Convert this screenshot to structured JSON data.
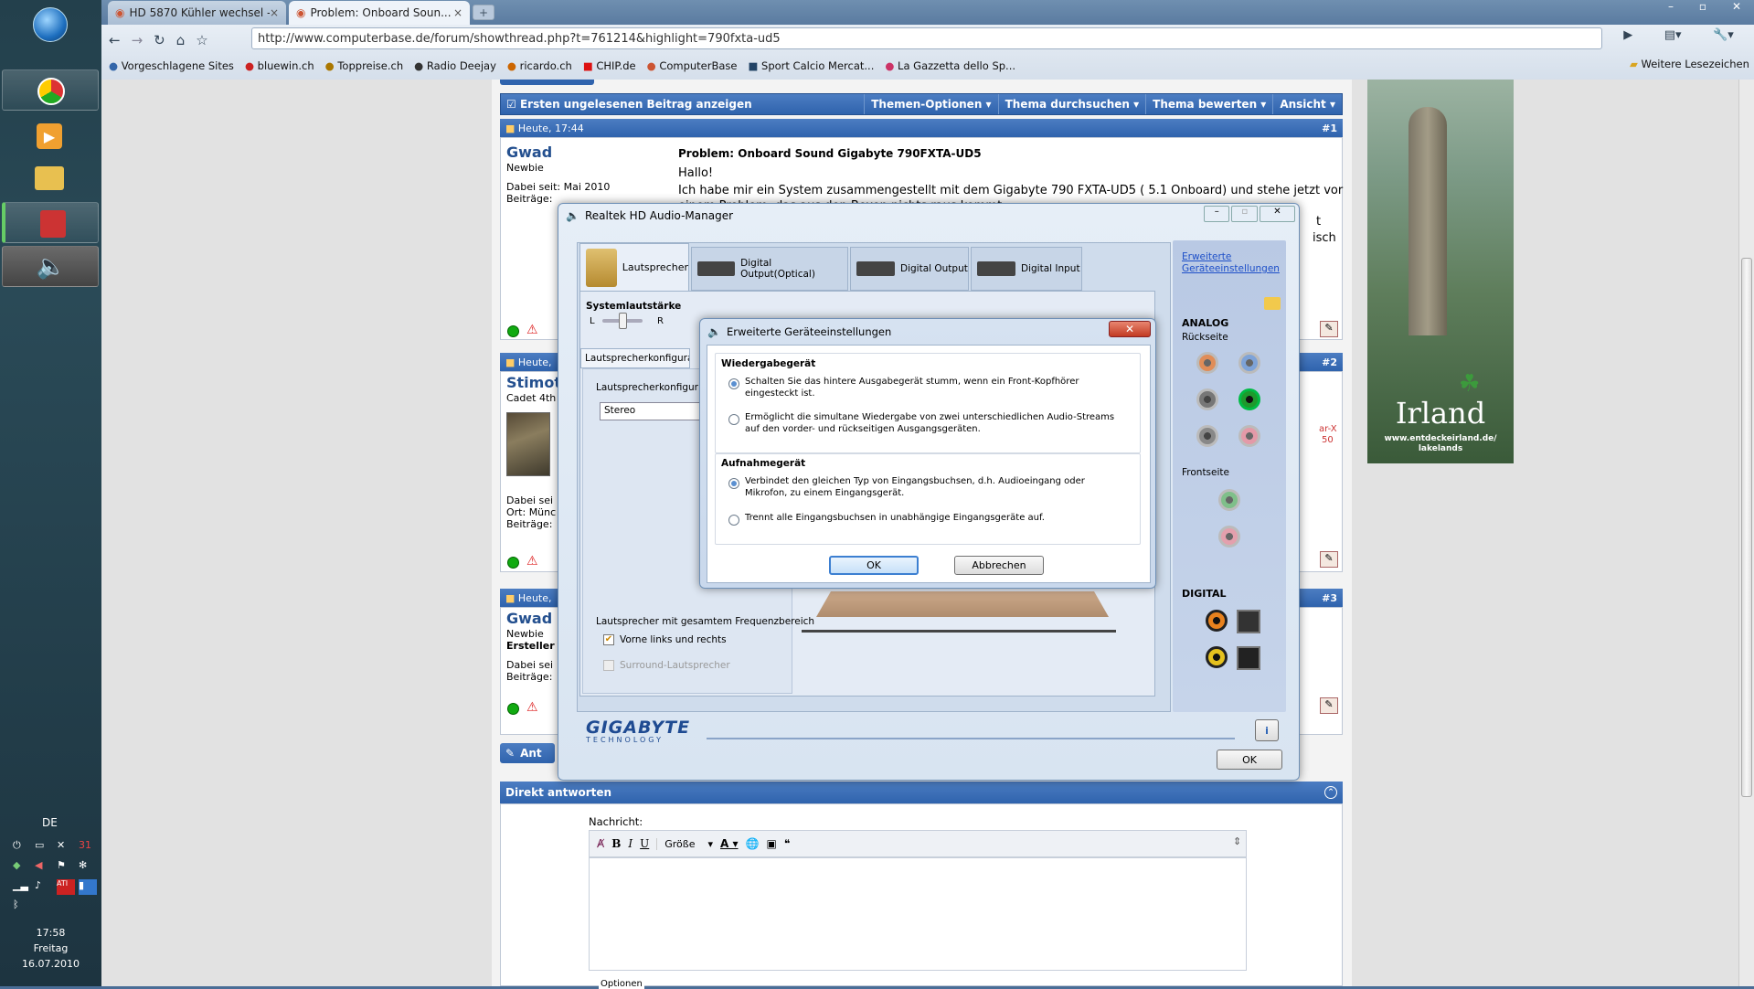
{
  "taskbar": {
    "lang": "DE",
    "time": "17:58",
    "day": "Freitag",
    "date": "16.07.2010"
  },
  "browser": {
    "tabs": [
      {
        "title": "HD 5870 Kühler wechsel -..."
      },
      {
        "title": "Problem: Onboard Soun..."
      }
    ],
    "url": "http://www.computerbase.de/forum/showthread.php?t=761214&highlight=790fxta-ud5",
    "bookmarks": [
      "Vorgeschlagene Sites",
      "bluewin.ch",
      "Toppreise.ch",
      "Radio Deejay",
      "ricardo.ch",
      "CHIP.de",
      "ComputerBase",
      "Sport Calcio Mercat...",
      "La Gazzetta dello Sp..."
    ],
    "other_bookmarks": "Weitere Lesezeichen"
  },
  "forum": {
    "toolbar": {
      "first_unread": "Ersten ungelesenen Beitrag anzeigen",
      "menus": [
        "Themen-Optionen",
        "Thema durchsuchen",
        "Thema bewerten",
        "Ansicht"
      ]
    },
    "posts": [
      {
        "date": "Heute, 17:44",
        "num": "#1",
        "user": "Gwad",
        "rank": "Newbie",
        "joined": "Dabei seit: Mai 2010",
        "posts_label": "Beiträge:",
        "title": "Problem: Onboard Sound Gigabyte 790FXTA-UD5",
        "greeting": "Hallo!",
        "body": "Ich habe mir ein System zusammengestellt mit dem Gigabyte 790 FXTA-UD5 ( 5.1 Onboard) und stehe jetzt vor",
        "body2": "einem Problem, das aus den Boxen nichts raus kommt.",
        "frag1": "t",
        "frag2": "isch"
      },
      {
        "date": "Heute,",
        "num": "#2",
        "user": "Stimot",
        "rank": "Cadet 4th",
        "joined": "Dabei sei",
        "place": "Ort: Münc",
        "posts_label": "Beiträge:",
        "red1": "ar-X",
        "red2": "50"
      },
      {
        "date": "Heute,",
        "num": "#3",
        "user": "Gwad",
        "rank": "Newbie",
        "creator": "Ersteller",
        "joined": "Dabei sei",
        "posts_label": "Beiträge:"
      }
    ],
    "reply": {
      "title": "Direkt antworten",
      "label": "Nachricht:",
      "size": "Größe",
      "options": "Optionen"
    },
    "answer_btn": "Ant"
  },
  "ad": {
    "title": "Irland",
    "url": "www.entdeckeirland.de/",
    "sub": "lakelands"
  },
  "realtek": {
    "title": "Realtek HD Audio-Manager",
    "tabs": [
      "Lautsprecher",
      "Digital Output(Optical)",
      "Digital Output",
      "Digital Input"
    ],
    "advanced_link_1": "Erweiterte",
    "advanced_link_2": "Geräteeinstellungen",
    "volume_label": "Systemlautstärke",
    "vol_l": "L",
    "vol_r": "R",
    "speaker_config": "Lautsprecherkonfigurati",
    "speaker_config_sub": "Lautsprecherkonfigur",
    "speaker_select": "Stereo",
    "fullrange": "Lautsprecher mit gesamtem Frequenzbereich",
    "front_lr": "Vorne links und rechts",
    "surround": "Surround-Lautsprecher",
    "analog": "ANALOG",
    "rear": "Rückseite",
    "front": "Frontseite",
    "digital": "DIGITAL",
    "brand": "GIGABYTE",
    "brand_sub": "TECHNOLOGY",
    "ok": "OK"
  },
  "dialog": {
    "title": "Erweiterte Geräteeinstellungen",
    "playback": "Wiedergabegerät",
    "opt1": "Schalten Sie das hintere Ausgabegerät stumm, wenn ein Front-Kopfhörer eingesteckt ist.",
    "opt2": "Ermöglicht die simultane Wiedergabe von zwei unterschiedlichen Audio-Streams auf den vorder- und rückseitigen Ausgangsgeräten.",
    "record": "Aufnahmegerät",
    "opt3": "Verbindet den gleichen Typ von Eingangsbuchsen, d.h. Audioeingang oder Mikrofon, zu einem Eingangsgerät.",
    "opt4": "Trennt alle Eingangsbuchsen in unabhängige Eingangsgeräte auf.",
    "ok": "OK",
    "cancel": "Abbrechen"
  }
}
